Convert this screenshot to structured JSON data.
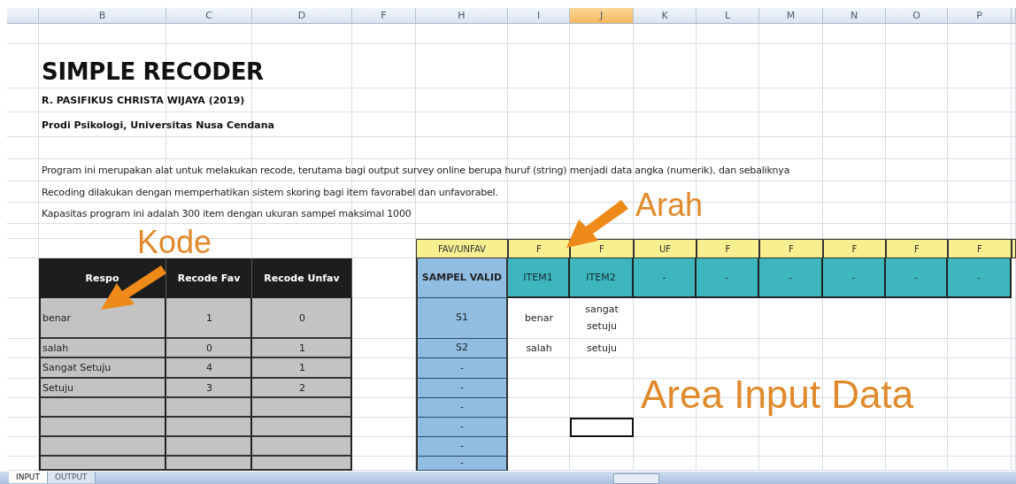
{
  "column_headers": [
    {
      "label": "B",
      "selected": false
    },
    {
      "label": "C",
      "selected": false
    },
    {
      "label": "D",
      "selected": false
    },
    {
      "label": "F",
      "selected": false
    },
    {
      "label": "H",
      "selected": false
    },
    {
      "label": "I",
      "selected": false
    },
    {
      "label": "J",
      "selected": true
    },
    {
      "label": "K",
      "selected": false
    },
    {
      "label": "L",
      "selected": false
    },
    {
      "label": "M",
      "selected": false
    },
    {
      "label": "N",
      "selected": false
    },
    {
      "label": "O",
      "selected": false
    },
    {
      "label": "P",
      "selected": false
    }
  ],
  "title": "SIMPLE RECODER",
  "author": "R. PASIFIKUS CHRISTA WIJAYA (2019)",
  "affiliation": "Prodi Psikologi, Universitas Nusa Cendana",
  "description": [
    "Program ini merupakan alat untuk melakukan recode, terutama bagi output survey online berupa huruf (string) menjadi data angka (numerik), dan sebaliknya",
    "Recoding dilakukan dengan memperhatikan sistem skoring bagi item favorabel dan unfavorabel.",
    "Kapasitas program ini adalah 300 item dengan ukuran sampel maksimal 1000"
  ],
  "code_table": {
    "columns": [
      "Respo",
      "Recode Fav",
      "Recode Unfav"
    ],
    "rows": [
      {
        "respon": "benar",
        "fav": "1",
        "unfav": "0"
      },
      {
        "respon": "salah",
        "fav": "0",
        "unfav": "1"
      },
      {
        "respon": "Sangat Setuju",
        "fav": "4",
        "unfav": "1"
      },
      {
        "respon": "Setuju",
        "fav": "3",
        "unfav": "2"
      },
      {},
      {},
      {},
      {}
    ]
  },
  "direction_row": {
    "label": "FAV/UNFAV",
    "values": [
      "F",
      "F",
      "UF",
      "F",
      "F",
      "F",
      "F",
      "F"
    ]
  },
  "item_header": {
    "label": "SAMPEL VALID",
    "items": [
      "ITEM1",
      "ITEM2",
      "-",
      "-",
      "-",
      "-",
      "-",
      "-"
    ]
  },
  "data_rows": [
    {
      "sample": "S1",
      "selected": false,
      "cells": [
        "benar",
        "sangat setuju"
      ]
    },
    {
      "sample": "S2",
      "selected": false,
      "cells": [
        "salah",
        "setuju"
      ]
    },
    {
      "sample": "-",
      "selected": false
    },
    {
      "sample": "-",
      "selected": false
    },
    {
      "sample": "-",
      "selected": false
    },
    {
      "sample": "-",
      "selected": true
    },
    {
      "sample": "-",
      "selected": false
    },
    {
      "sample": "-",
      "selected": false
    }
  ],
  "annotations": {
    "code": "Kode",
    "direction": "Arah",
    "input_area": "Area Input Data"
  },
  "sheet_tabs": [
    {
      "label": "INPUT",
      "selected": true
    },
    {
      "label": "OUTPUT",
      "selected": false
    }
  ]
}
